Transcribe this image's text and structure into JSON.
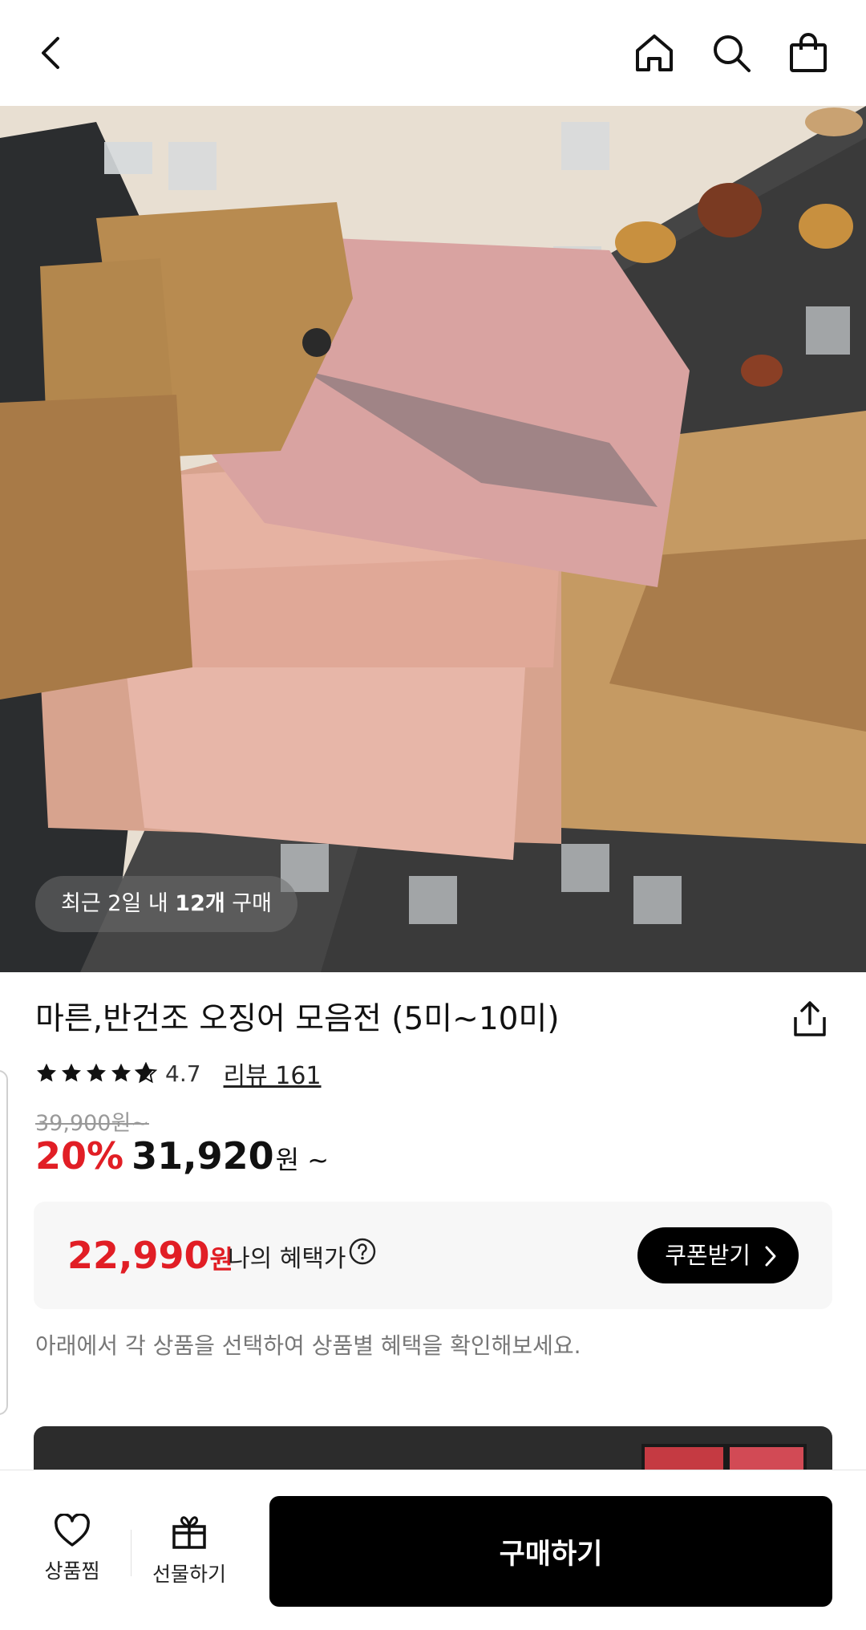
{
  "header": {
    "icons": [
      "back-icon",
      "home-icon",
      "search-icon",
      "shopping-bag-icon"
    ]
  },
  "hero": {
    "purchase_prefix": "최근 2일 내 ",
    "purchase_count": "12개",
    "purchase_suffix": " 구매"
  },
  "product": {
    "title": "마른,반건조 오징어 모음전 (5미~10미)",
    "rating": "4.7",
    "review_label": "리뷰 161",
    "original_price": "39,900원~",
    "discount": "20%",
    "price": "31,920",
    "price_suffix": "원 ~"
  },
  "benefit": {
    "price": "22,990",
    "price_unit": "원",
    "label": "나의 혜택가",
    "coupon_button": "쿠폰받기"
  },
  "notice": "아래에서 각 상품을 선택하여 상품별 혜택을 확인해보세요.",
  "bottom_bar": {
    "wish_label": "상품찜",
    "gift_label": "선물하기",
    "buy_label": "구매하기"
  },
  "colors": {
    "accent_red": "#e11e25",
    "button_black": "#000000"
  }
}
